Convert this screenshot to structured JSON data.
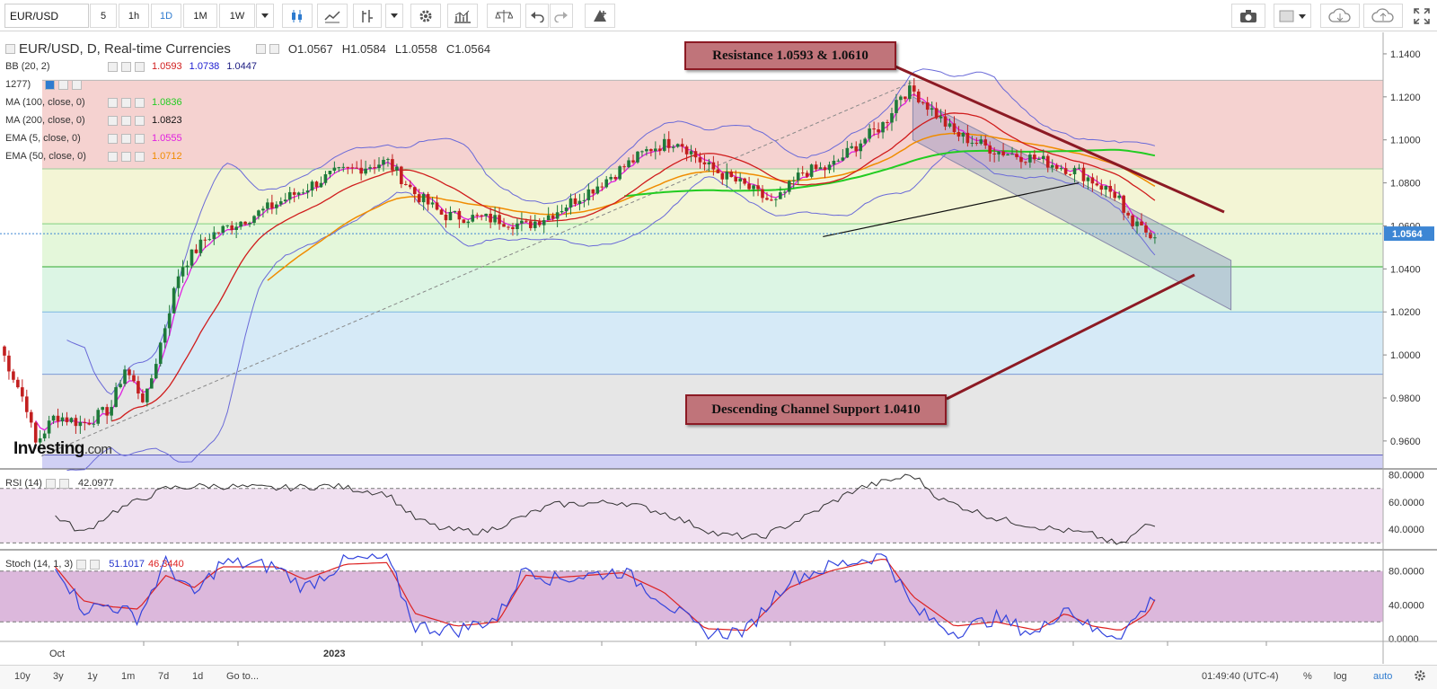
{
  "toolbar": {
    "symbol": "EUR/USD",
    "intervals": [
      "5",
      "1h",
      "1D",
      "1M",
      "1W"
    ],
    "active_interval": "1D",
    "dropdown_icon": "chevron-down-icon",
    "icons": [
      "candles-icon",
      "line-chart-icon",
      "indicator-icon",
      "settings-icon",
      "studies-icon",
      "compare-icon",
      "undo-icon",
      "redo-icon",
      "alert-icon",
      "camera-icon",
      "square-icon",
      "cloud-download-icon",
      "cloud-upload-icon",
      "fullscreen-icon"
    ]
  },
  "legend": {
    "title": "EUR/USD, D, Real-time Currencies",
    "ohlc": {
      "o": "O1.0567",
      "h": "H1.0584",
      "l": "L1.0558",
      "c": "C1.0564"
    },
    "indicators": [
      {
        "label": "BB (20, 2)",
        "values": [
          "1.0593",
          "1.0738",
          "1.0447"
        ],
        "colors": [
          "#d01c1c",
          "#1a1ad0",
          "#1a1a80"
        ]
      },
      {
        "label": "1277)",
        "values": [],
        "colors": []
      },
      {
        "label": "MA (100, close, 0)",
        "values": [
          "1.0836"
        ],
        "colors": [
          "#22cc22"
        ]
      },
      {
        "label": "MA (200, close, 0)",
        "values": [
          "1.0823"
        ],
        "colors": [
          "#111111"
        ]
      },
      {
        "label": "EMA (5, close, 0)",
        "values": [
          "1.0555"
        ],
        "colors": [
          "#e020e0"
        ]
      },
      {
        "label": "EMA (50, close, 0)",
        "values": [
          "1.0712"
        ],
        "colors": [
          "#f08c00"
        ]
      }
    ]
  },
  "annotations": {
    "resistance": "Resistance 1.0593 & 1.0610",
    "support": "Descending Channel Support 1.0410"
  },
  "watermark": {
    "brand": "Investing",
    "suffix": ".com"
  },
  "colors": {
    "up": "#1e7a3a",
    "down": "#c21f1f",
    "current_price_bg": "#3d86d4",
    "annotation_fill": "#c0747a",
    "annotation_border": "#8c1a24"
  },
  "chart_data": [
    {
      "type": "candlestick",
      "title": "EUR/USD, D, Real-time Currencies",
      "y_ticks": [
        "1.1400",
        "1.1200",
        "1.1000",
        "1.0800",
        "1.0600",
        "1.0400",
        "1.0200",
        "1.0000",
        "0.9800",
        "0.9600"
      ],
      "ylim": [
        0.947,
        1.15
      ],
      "current_price": "1.0564",
      "x_tick_labels": [
        "Oct",
        "2023"
      ],
      "fib_levels": [
        1.1277,
        1.0865,
        1.061,
        1.041,
        1.02,
        0.991,
        0.9535
      ],
      "fib_fill_colors": [
        "#f5d2d0",
        "#f3f5d5",
        "#e4f7da",
        "#dcf5e4",
        "#d6eaf7",
        "#e6e6e6",
        "#d0d0f4"
      ],
      "channel": {
        "upper": [
          [
            0.66,
            1.12
          ],
          [
            0.89,
            1.044
          ]
        ],
        "lower": [
          [
            0.66,
            1.1
          ],
          [
            0.89,
            1.021
          ]
        ]
      },
      "trendline_dashed": [
        [
          0.03,
          0.953
        ],
        [
          0.66,
          1.127
        ]
      ],
      "ma200_segment": [
        [
          0.595,
          1.055
        ],
        [
          0.78,
          1.08
        ]
      ],
      "series": [
        {
          "name": "Close",
          "anchors": [
            [
              0,
              1.004
            ],
            [
              0.02,
              0.975
            ],
            [
              0.025,
              0.958
            ],
            [
              0.04,
              0.972
            ],
            [
              0.06,
              0.968
            ],
            [
              0.08,
              0.975
            ],
            [
              0.09,
              0.994
            ],
            [
              0.105,
              0.978
            ],
            [
              0.13,
              1.04
            ],
            [
              0.15,
              1.055
            ],
            [
              0.19,
              1.067
            ],
            [
              0.24,
              1.084
            ],
            [
              0.28,
              1.09
            ],
            [
              0.3,
              1.075
            ],
            [
              0.32,
              1.065
            ],
            [
              0.36,
              1.063
            ],
            [
              0.38,
              1.06
            ],
            [
              0.4,
              1.066
            ],
            [
              0.43,
              1.078
            ],
            [
              0.45,
              1.087
            ],
            [
              0.47,
              1.096
            ],
            [
              0.49,
              1.1
            ],
            [
              0.51,
              1.088
            ],
            [
              0.54,
              1.078
            ],
            [
              0.56,
              1.07
            ],
            [
              0.58,
              1.085
            ],
            [
              0.6,
              1.087
            ],
            [
              0.62,
              1.098
            ],
            [
              0.64,
              1.108
            ],
            [
              0.65,
              1.121
            ],
            [
              0.66,
              1.123
            ],
            [
              0.69,
              1.103
            ],
            [
              0.72,
              1.095
            ],
            [
              0.75,
              1.091
            ],
            [
              0.78,
              1.085
            ],
            [
              0.81,
              1.073
            ],
            [
              0.8,
              1.07
            ],
            [
              0.82,
              1.06
            ],
            [
              0.83,
              1.057
            ],
            [
              0.835,
              1.0564
            ]
          ]
        }
      ]
    },
    {
      "type": "line",
      "panel": "RSI (14)",
      "value_label": "42.0977",
      "y_ticks": [
        "80.0000",
        "60.0000",
        "40.0000"
      ],
      "ylim": [
        25,
        83
      ],
      "bands": [
        70,
        30
      ],
      "series": [
        {
          "name": "RSI",
          "anchors": [
            [
              0.04,
              50
            ],
            [
              0.06,
              37
            ],
            [
              0.08,
              52
            ],
            [
              0.12,
              70
            ],
            [
              0.15,
              72
            ],
            [
              0.2,
              70
            ],
            [
              0.24,
              72
            ],
            [
              0.28,
              66
            ],
            [
              0.3,
              48
            ],
            [
              0.32,
              40
            ],
            [
              0.35,
              38
            ],
            [
              0.4,
              58
            ],
            [
              0.45,
              60
            ],
            [
              0.48,
              52
            ],
            [
              0.52,
              36
            ],
            [
              0.55,
              34
            ],
            [
              0.58,
              48
            ],
            [
              0.62,
              70
            ],
            [
              0.66,
              80
            ],
            [
              0.68,
              62
            ],
            [
              0.72,
              48
            ],
            [
              0.75,
              42
            ],
            [
              0.79,
              36
            ],
            [
              0.81,
              28
            ],
            [
              0.83,
              44
            ],
            [
              0.835,
              42.1
            ]
          ]
        }
      ]
    },
    {
      "type": "line",
      "panel": "Stoch (14, 1, 3)",
      "value_labels": [
        "51.1017",
        "46.3440"
      ],
      "y_ticks": [
        "80.0000",
        "40.0000",
        "0.0000"
      ],
      "ylim": [
        -3,
        103
      ],
      "bands": [
        80,
        20
      ],
      "series": [
        {
          "name": "%K",
          "anchors": [
            [
              0.04,
              90
            ],
            [
              0.06,
              35
            ],
            [
              0.08,
              40
            ],
            [
              0.1,
              25
            ],
            [
              0.12,
              90
            ],
            [
              0.14,
              50
            ],
            [
              0.16,
              90
            ],
            [
              0.2,
              85
            ],
            [
              0.22,
              60
            ],
            [
              0.25,
              92
            ],
            [
              0.28,
              95
            ],
            [
              0.3,
              15
            ],
            [
              0.33,
              10
            ],
            [
              0.36,
              25
            ],
            [
              0.38,
              85
            ],
            [
              0.4,
              70
            ],
            [
              0.45,
              80
            ],
            [
              0.48,
              45
            ],
            [
              0.51,
              5
            ],
            [
              0.54,
              10
            ],
            [
              0.57,
              70
            ],
            [
              0.6,
              85
            ],
            [
              0.64,
              100
            ],
            [
              0.66,
              35
            ],
            [
              0.69,
              8
            ],
            [
              0.72,
              25
            ],
            [
              0.75,
              5
            ],
            [
              0.77,
              40
            ],
            [
              0.79,
              10
            ],
            [
              0.81,
              5
            ],
            [
              0.83,
              40
            ],
            [
              0.835,
              51.1
            ]
          ]
        },
        {
          "name": "%D",
          "anchors": [
            [
              0.04,
              85
            ],
            [
              0.06,
              45
            ],
            [
              0.08,
              38
            ],
            [
              0.1,
              35
            ],
            [
              0.12,
              75
            ],
            [
              0.14,
              60
            ],
            [
              0.16,
              85
            ],
            [
              0.2,
              85
            ],
            [
              0.22,
              70
            ],
            [
              0.25,
              88
            ],
            [
              0.28,
              90
            ],
            [
              0.3,
              30
            ],
            [
              0.33,
              15
            ],
            [
              0.36,
              20
            ],
            [
              0.38,
              75
            ],
            [
              0.4,
              72
            ],
            [
              0.45,
              78
            ],
            [
              0.48,
              55
            ],
            [
              0.51,
              12
            ],
            [
              0.54,
              10
            ],
            [
              0.57,
              60
            ],
            [
              0.6,
              80
            ],
            [
              0.64,
              95
            ],
            [
              0.66,
              50
            ],
            [
              0.69,
              15
            ],
            [
              0.72,
              20
            ],
            [
              0.75,
              10
            ],
            [
              0.77,
              30
            ],
            [
              0.79,
              15
            ],
            [
              0.81,
              10
            ],
            [
              0.83,
              30
            ],
            [
              0.835,
              46.3
            ]
          ]
        }
      ]
    }
  ],
  "bottom": {
    "ranges": [
      "10y",
      "3y",
      "1y",
      "1m",
      "7d",
      "1d",
      "Go to..."
    ],
    "time": "01:49:40 (UTC-4)",
    "percent": "%",
    "log": "log",
    "auto": "auto",
    "gear_icon": "gear-icon"
  }
}
